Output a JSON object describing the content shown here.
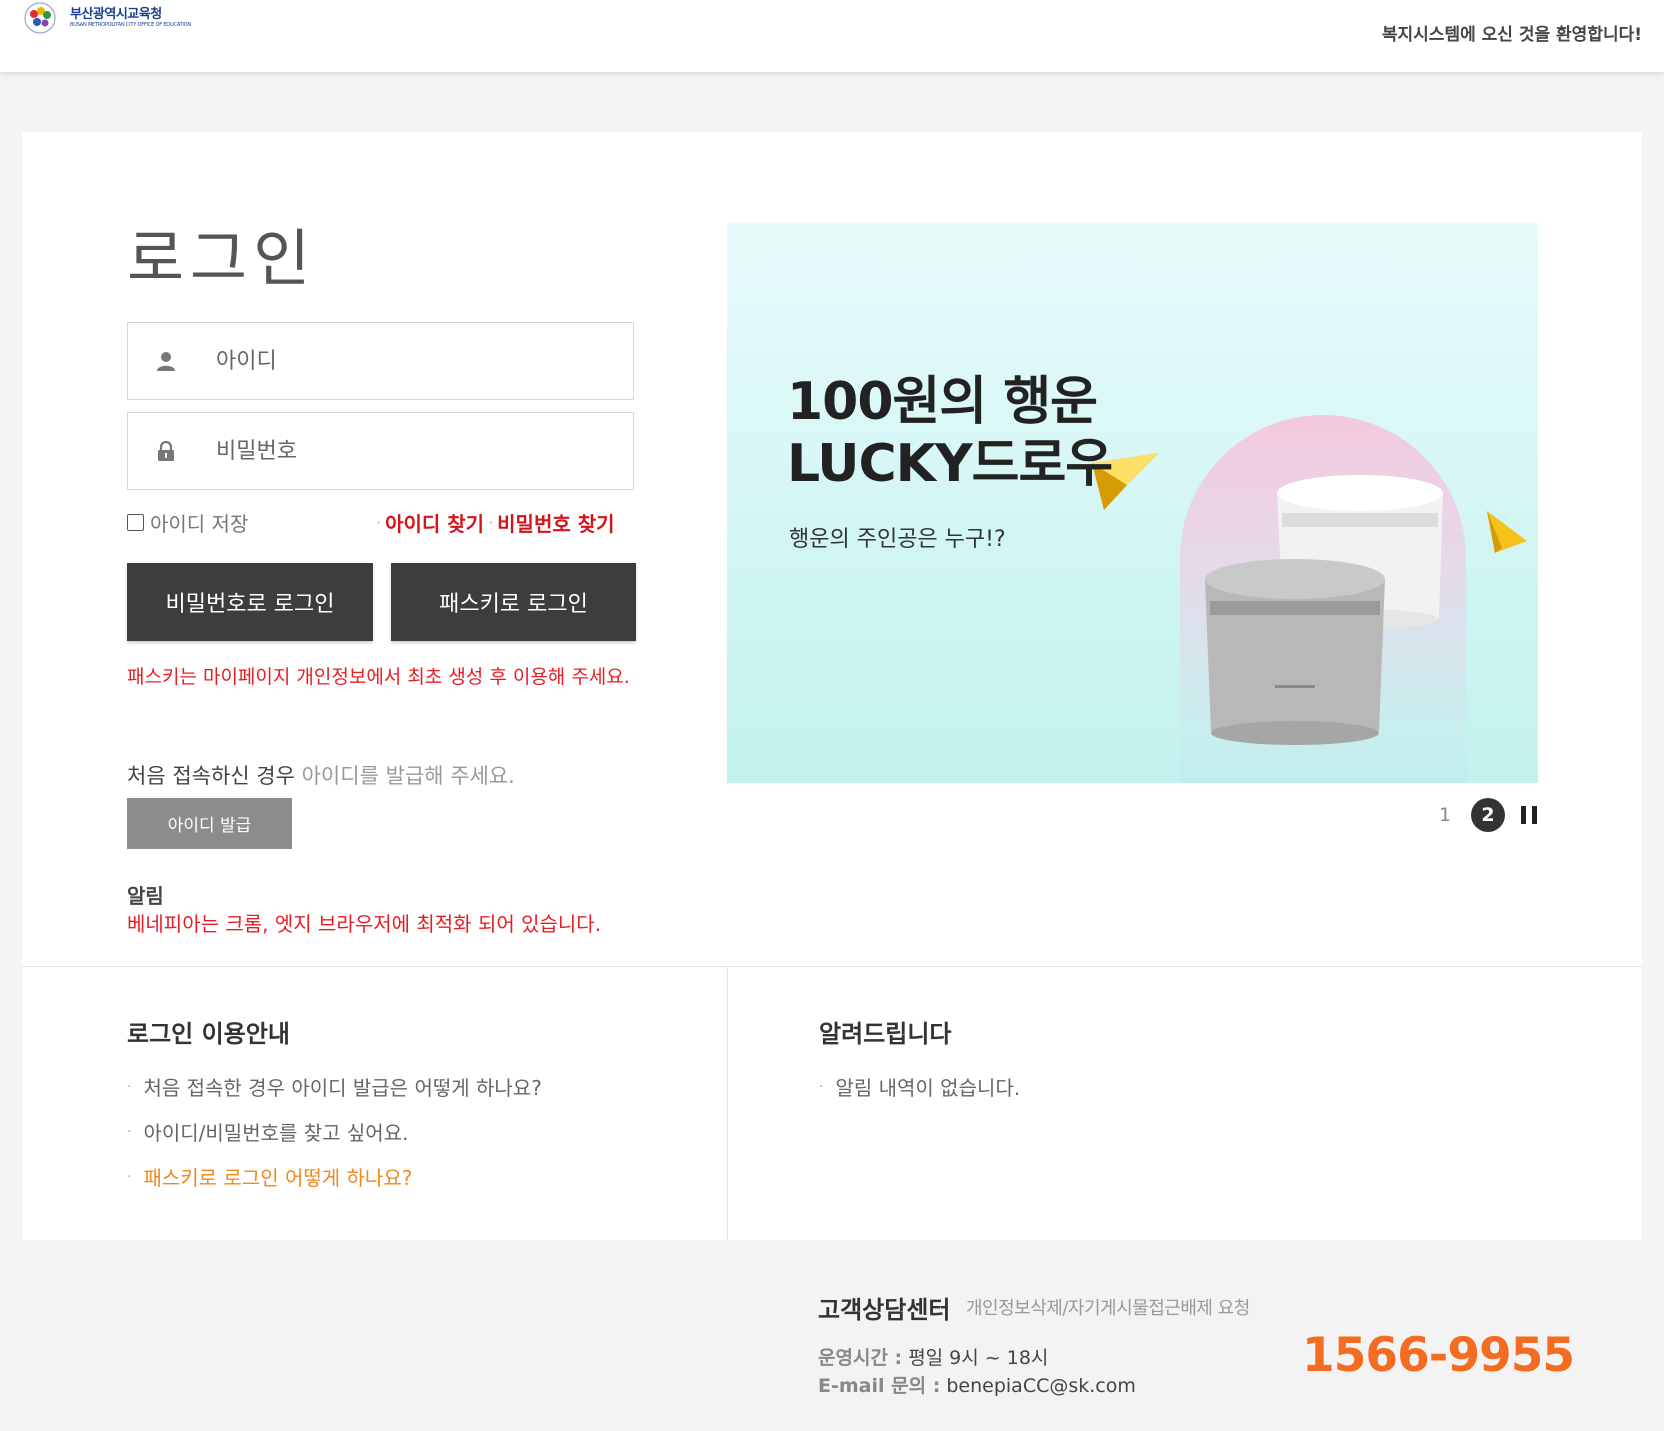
{
  "header": {
    "logo_name": "부산광역시교육청",
    "logo_sub": "BUSAN METROPOLITAN CITY OFFICE OF EDUCATION",
    "welcome": "복지시스템에 오신 것을 환영합니다!"
  },
  "login": {
    "title": "로그인",
    "id_placeholder": "아이디",
    "pw_placeholder": "비밀번호",
    "save_id": "아이디 저장",
    "find_id": "아이디 찾기",
    "find_pw": "비밀번호 찾기",
    "btn_password_login": "비밀번호로 로그인",
    "btn_passkey_login": "패스키로 로그인",
    "passkey_note": "패스키는 마이페이지 개인정보에서 최초 생성 후 이용해 주세요.",
    "first_visit": "처음 접속하신 경우",
    "first_visit_hint": "아이디를 발급해 주세요.",
    "btn_issue_id": "아이디 발급",
    "notice_label": "알림",
    "notice_text": "베네피아는 크롬, 엣지 브라우저에 최적화 되어 있습니다."
  },
  "banner": {
    "line1": "100원의 행운",
    "line2": "LUCKY드로우",
    "sub": "행운의 주인공은 누구!?",
    "slides": [
      "1",
      "2"
    ],
    "active_slide": "2"
  },
  "guide": {
    "title": "로그인 이용안내",
    "items": [
      "처음 접속한 경우 아이디 발급은 어떻게 하나요?",
      "아이디/비밀번호를 찾고 싶어요.",
      "패스키로 로그인 어떻게 하나요?"
    ]
  },
  "announce": {
    "title": "알려드립니다",
    "items": [
      "알림 내역이 없습니다."
    ]
  },
  "footer": {
    "cs_title": "고객상담센터",
    "cs_request": "개인정보삭제/자기게시물접근배제 요청",
    "hours_key": "운영시간 :",
    "hours_val": "평일 9시 ~ 18시",
    "mail_key": "E-mail 문의 :",
    "mail_val": "benepiaCC@sk.com",
    "phone": "1566-9955"
  },
  "colors": {
    "accent_red": "#e81e25",
    "phone_orange": "#f36c21",
    "button_dark": "#3d3d3d",
    "link_orange": "#f0891e"
  }
}
